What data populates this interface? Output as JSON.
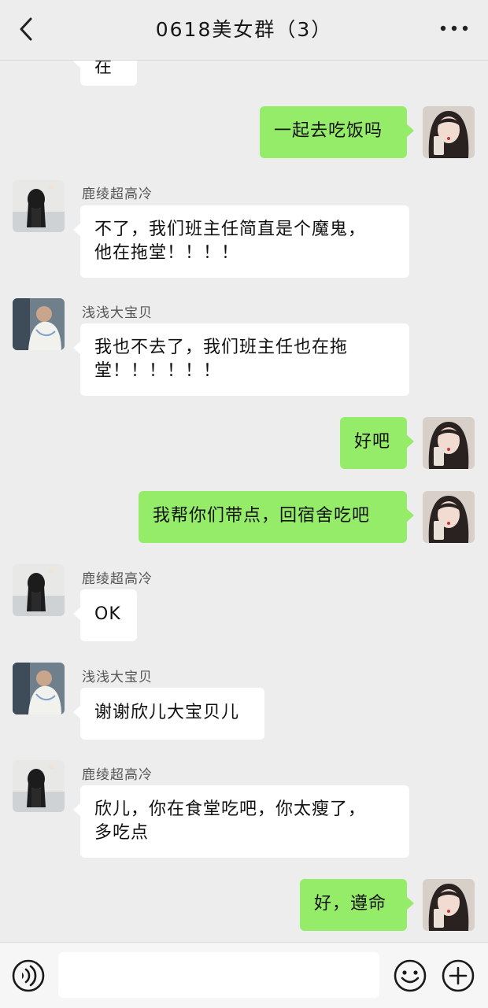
{
  "header": {
    "title": "0618美女群（3）",
    "back_icon": "chevron-left-icon",
    "more_icon": "ellipsis-icon"
  },
  "members": {
    "lu": "鹿绫超高冷",
    "qian": "浅浅大宝贝"
  },
  "messages": [
    {
      "text": "在"
    },
    {
      "text": "一起去吃饭吗"
    },
    {
      "sender": "鹿绫超高冷",
      "text_line1": "不了，我们班主任简直是个魔鬼，",
      "text_line2": "他在拖堂！！！！"
    },
    {
      "sender": "浅浅大宝贝",
      "text_line1": "我也不去了，我们班主任也在拖",
      "text_line2": "堂！！！！！！"
    },
    {
      "text": "好吧"
    },
    {
      "text": "我帮你们带点，回宿舍吃吧"
    },
    {
      "sender": "鹿绫超高冷",
      "text": "OK"
    },
    {
      "sender": "浅浅大宝贝",
      "text": "谢谢欣儿大宝贝儿"
    },
    {
      "sender": "鹿绫超高冷",
      "text_line1": "欣儿，你在食堂吃吧，你太瘦了，",
      "text_line2": "多吃点"
    },
    {
      "text": "好，遵命"
    }
  ],
  "input": {
    "value": "",
    "voice_icon": "voice-icon",
    "emoji_icon": "emoji-icon",
    "plus_icon": "plus-icon"
  },
  "colors": {
    "background": "#ededed",
    "outgoing_bubble": "#95ec69",
    "incoming_bubble": "#ffffff"
  }
}
